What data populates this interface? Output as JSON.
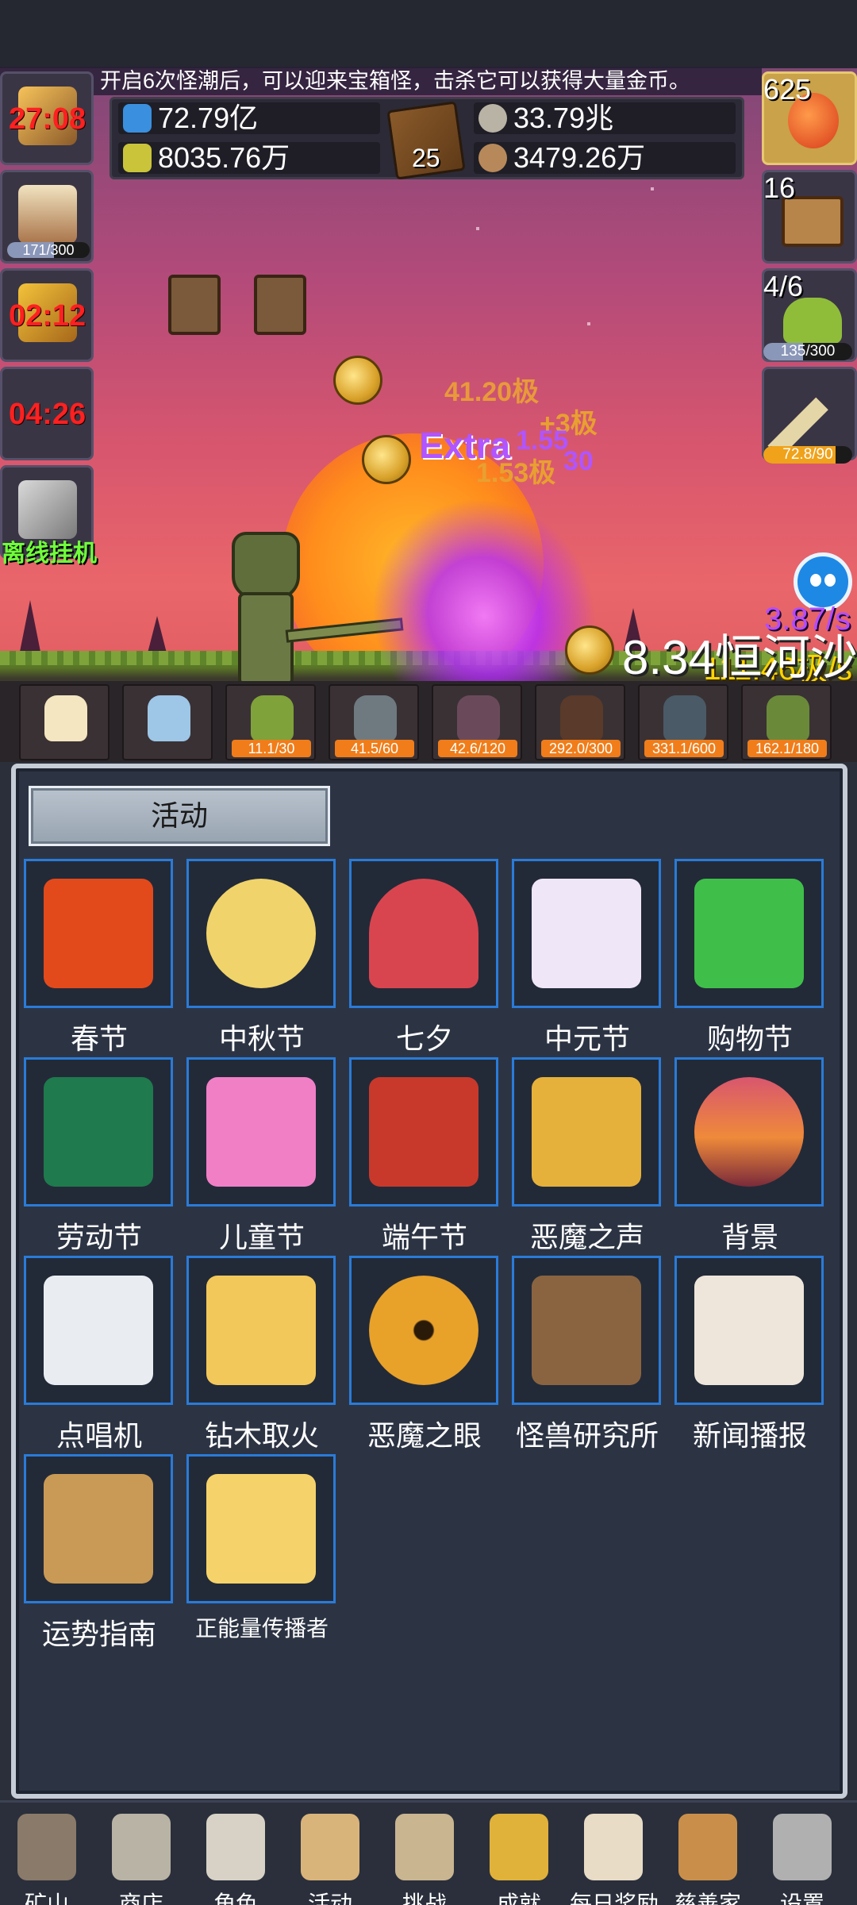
{
  "banner": "开启6次怪潮后，可以迎来宝箱怪，击杀它可以获得大量金币。",
  "resources": {
    "potion_blue": "72.79亿",
    "potion_yellow": "8035.76万",
    "book_level": "25",
    "silver_coin": "33.79兆",
    "seed": "3479.26万"
  },
  "left_buttons": {
    "timer1": "27:08",
    "beer_progress": "171/300",
    "beer_fill": 0.57,
    "timer2": "02:12",
    "timer3": "04:26",
    "offline_label": "离线挂机"
  },
  "right_buttons": {
    "potion_count": "625",
    "chest_count": "16",
    "slime_wave": "4/6",
    "slime_progress": "135/300",
    "slime_fill": 0.45,
    "sword_progress": "72.8/90",
    "sword_fill": 0.81
  },
  "speed_purple": "3.87/s",
  "speed_gold": "111.46极/s",
  "gold_total": "8.34恒河沙",
  "battle_fx": {
    "extra": "Extra",
    "f1": "41.20极",
    "f2": "+3极",
    "f3": "1.55",
    "f4": "1.53极",
    "f5": "30"
  },
  "monster_slots": [
    {
      "name": "candle-slot",
      "tag": ""
    },
    {
      "name": "egg-slot",
      "tag": ""
    },
    {
      "name": "slime-slot",
      "tag": "11.1/30"
    },
    {
      "name": "zombie-slot",
      "tag": "41.5/60"
    },
    {
      "name": "bat-slot",
      "tag": "42.6/120"
    },
    {
      "name": "spider-slot",
      "tag": "292.0/300"
    },
    {
      "name": "ghoul-slot",
      "tag": "331.1/600"
    },
    {
      "name": "goblin-slot",
      "tag": "162.1/180"
    }
  ],
  "panel_title": "活动",
  "tiles": [
    {
      "label": "春节",
      "icon": "lantern-icon",
      "color": "#e24a1c"
    },
    {
      "label": "中秋节",
      "icon": "moon-icon",
      "color": "#f0d36a"
    },
    {
      "label": "七夕",
      "icon": "heart-icon",
      "color": "#d9454f"
    },
    {
      "label": "中元节",
      "icon": "ghost-icon",
      "color": "#efe6f7"
    },
    {
      "label": "购物节",
      "icon": "cash-icon",
      "color": "#3fbf4a"
    },
    {
      "label": "劳动节",
      "icon": "brush-icon",
      "color": "#1f7a4d"
    },
    {
      "label": "儿童节",
      "icon": "lollipop-icon",
      "color": "#f07fc6"
    },
    {
      "label": "端午节",
      "icon": "dragon-mask-icon",
      "color": "#c8392b"
    },
    {
      "label": "恶魔之声",
      "icon": "bell-icon",
      "color": "#e6b13a"
    },
    {
      "label": "背景",
      "icon": "sunset-icon",
      "color": "#d8566e"
    },
    {
      "label": "点唱机",
      "icon": "cassette-icon",
      "color": "#e9edf2"
    },
    {
      "label": "钻木取火",
      "icon": "torch-icon",
      "color": "#f3c85a"
    },
    {
      "label": "恶魔之眼",
      "icon": "eye-icon",
      "color": "#d99a2a"
    },
    {
      "label": "怪兽研究所",
      "icon": "lab-crate-icon",
      "color": "#8a6440"
    },
    {
      "label": "新闻播报",
      "icon": "newspaper-icon",
      "color": "#eee6da"
    },
    {
      "label": "运势指南",
      "icon": "fortune-map-icon",
      "color": "#c99a55"
    },
    {
      "label": "正能量传播者",
      "icon": "crown-icon",
      "color": "#f5d36a"
    }
  ],
  "nav": [
    {
      "label": "矿山",
      "icon": "lantern-nav-icon"
    },
    {
      "label": "商店",
      "icon": "stone-nav-icon"
    },
    {
      "label": "角色",
      "icon": "skull-nav-icon"
    },
    {
      "label": "活动",
      "icon": "scroll-nav-icon"
    },
    {
      "label": "挑战",
      "icon": "map-nav-icon"
    },
    {
      "label": "成就",
      "icon": "key-nav-icon"
    },
    {
      "label": "每日奖励",
      "icon": "letter-nav-icon"
    },
    {
      "label": "慈善家",
      "icon": "bread-nav-icon"
    },
    {
      "label": "设置",
      "icon": "gear-nav-icon"
    }
  ]
}
